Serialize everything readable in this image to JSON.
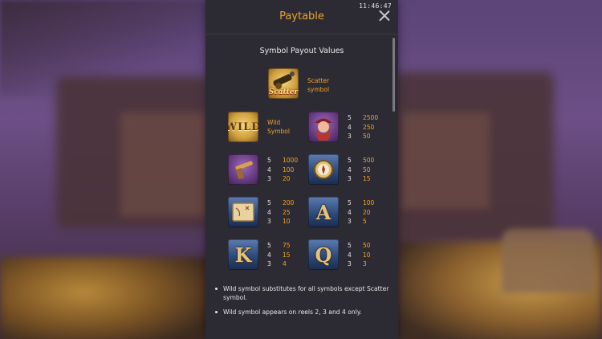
{
  "clock": "11:46:47",
  "header": {
    "title": "Paytable"
  },
  "section": {
    "subtitle": "Symbol Payout Values"
  },
  "symbols": [
    {
      "name": "scatter",
      "icon": "scatter-cannon-icon",
      "badge": "Scatter",
      "label": "Scatter symbol"
    },
    {
      "name": "wild",
      "icon": "wild-treasure-chest-icon",
      "badge": "WILD",
      "label": "Wild Symbol"
    },
    {
      "name": "pirate-woman",
      "icon": "pirate-woman-icon",
      "payouts": [
        {
          "count": "5",
          "value": "2500"
        },
        {
          "count": "4",
          "value": "250"
        },
        {
          "count": "3",
          "value": "50"
        }
      ]
    },
    {
      "name": "pistol",
      "icon": "flintlock-pistol-icon",
      "payouts": [
        {
          "count": "5",
          "value": "1000"
        },
        {
          "count": "4",
          "value": "100"
        },
        {
          "count": "3",
          "value": "20"
        }
      ]
    },
    {
      "name": "compass",
      "icon": "compass-icon",
      "payouts": [
        {
          "count": "5",
          "value": "500"
        },
        {
          "count": "4",
          "value": "50"
        },
        {
          "count": "3",
          "value": "15"
        }
      ]
    },
    {
      "name": "map",
      "icon": "treasure-map-icon",
      "payouts": [
        {
          "count": "5",
          "value": "200"
        },
        {
          "count": "4",
          "value": "25"
        },
        {
          "count": "3",
          "value": "10"
        }
      ]
    },
    {
      "name": "A",
      "icon": "letter-a-icon",
      "letter": "A",
      "payouts": [
        {
          "count": "5",
          "value": "100"
        },
        {
          "count": "4",
          "value": "20"
        },
        {
          "count": "3",
          "value": "5"
        }
      ]
    },
    {
      "name": "K",
      "icon": "letter-k-icon",
      "letter": "K",
      "payouts": [
        {
          "count": "5",
          "value": "75"
        },
        {
          "count": "4",
          "value": "15"
        },
        {
          "count": "3",
          "value": "4"
        }
      ]
    },
    {
      "name": "Q",
      "icon": "letter-q-icon",
      "letter": "Q",
      "payouts": [
        {
          "count": "5",
          "value": "50"
        },
        {
          "count": "4",
          "value": "10"
        },
        {
          "count": "3",
          "value": "3"
        }
      ]
    }
  ],
  "notes": [
    "Wild symbol substitutes for all symbols except Scatter symbol.",
    "Wild symbol appears on reels 2, 3 and 4 only."
  ],
  "colors": {
    "accent": "#f0a32b",
    "panel": "#2c2b34",
    "text": "#e6e6e6"
  }
}
